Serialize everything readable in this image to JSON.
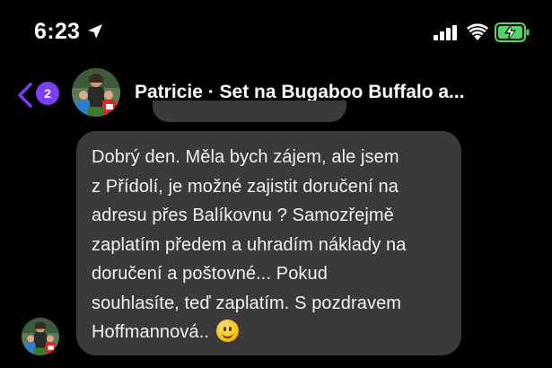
{
  "status_bar": {
    "time": "6:23",
    "icons": [
      "location-arrow-icon",
      "cellular-signal-icon",
      "wifi-icon",
      "battery-charging-icon"
    ],
    "battery_color": "#4cd964"
  },
  "header": {
    "back_badge_count": "2",
    "title": "Patricie · Set na Bugaboo Buffalo a...",
    "accent_color": "#7b3ff2"
  },
  "conversation": {
    "messages": [
      {
        "direction": "incoming",
        "text": "Dobrý den. Měla bych zájem, ale jsem\nz Přídolí, je možné zajistit doručení na\nadresu přes Balíkovnu ?  Samozřejmě\nzaplatím předem a uhradím náklady na\ndoručení a poštovné... Pokud\nsouhlasíte, teď zaplatím. S pozdravem\nHoffmannová.. ",
        "emoji": "slightly-smiling-face"
      }
    ]
  }
}
